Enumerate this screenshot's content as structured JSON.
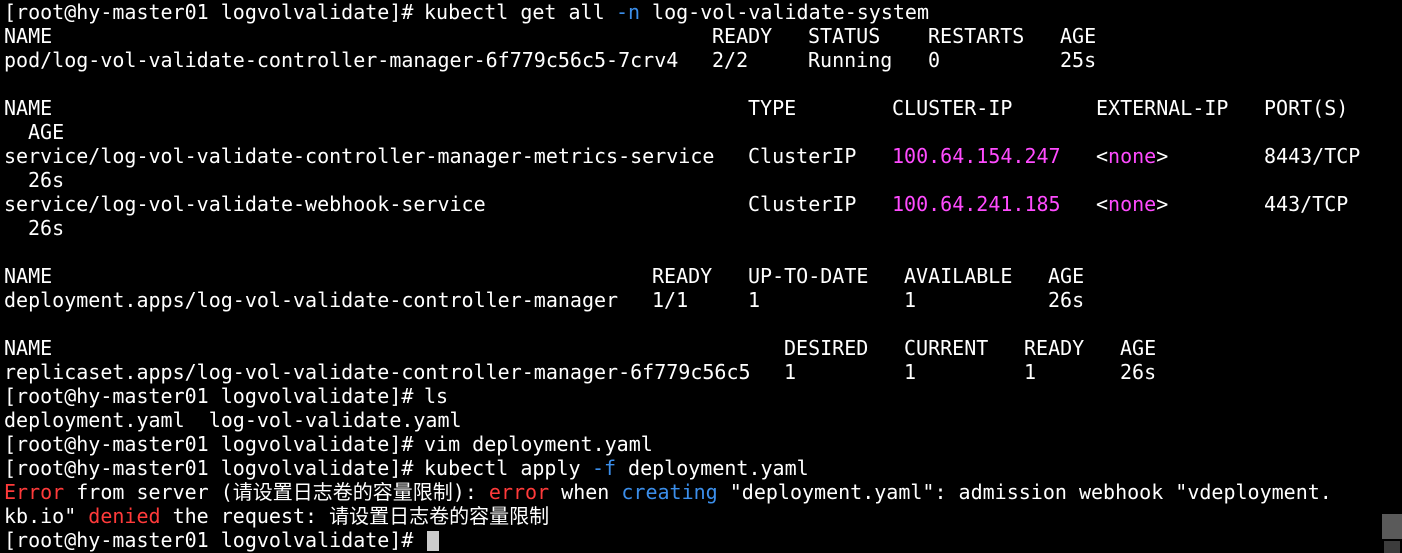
{
  "prompt": "[root@hy-master01 logvolvalidate]# ",
  "commands": {
    "get_all": {
      "cmd": "kubectl get all ",
      "flag": "-n",
      "arg": " log-vol-validate-system"
    },
    "ls": "ls",
    "vim": "vim deployment.yaml",
    "apply": {
      "cmd": "kubectl apply ",
      "flag": "-f",
      "arg": " deployment.yaml"
    }
  },
  "pods": {
    "headers": [
      "NAME",
      "READY",
      "STATUS",
      "RESTARTS",
      "AGE"
    ],
    "rows": [
      [
        "pod/log-vol-validate-controller-manager-6f779c56c5-7crv4",
        "2/2",
        "Running",
        "0",
        "25s"
      ]
    ]
  },
  "services": {
    "headers": [
      "NAME",
      "TYPE",
      "CLUSTER-IP",
      "EXTERNAL-IP",
      "PORT(S)",
      "AGE"
    ],
    "rows": [
      [
        "service/log-vol-validate-controller-manager-metrics-service",
        "ClusterIP",
        "100.64.154.247",
        "<none>",
        "8443/TCP",
        "26s"
      ],
      [
        "service/log-vol-validate-webhook-service",
        "ClusterIP",
        "100.64.241.185",
        "<none>",
        "443/TCP",
        "26s"
      ]
    ]
  },
  "deployments": {
    "headers": [
      "NAME",
      "READY",
      "UP-TO-DATE",
      "AVAILABLE",
      "AGE"
    ],
    "rows": [
      [
        "deployment.apps/log-vol-validate-controller-manager",
        "1/1",
        "1",
        "1",
        "26s"
      ]
    ]
  },
  "replicasets": {
    "headers": [
      "NAME",
      "DESIRED",
      "CURRENT",
      "READY",
      "AGE"
    ],
    "rows": [
      [
        "replicaset.apps/log-vol-validate-controller-manager-6f779c56c5",
        "1",
        "1",
        "1",
        "26s"
      ]
    ]
  },
  "ls_output": "deployment.yaml  log-vol-validate.yaml",
  "error": {
    "word_error": "Error",
    "part1": " from server (请设置日志卷的容量限制): ",
    "word_error2": "error",
    "part2": " when ",
    "word_creating": "creating",
    "part3": " \"deployment.yaml\": admission webhook \"vdeployment.",
    "part4": "kb.io\" ",
    "word_denied": "denied",
    "part5": " the request: 请设置日志卷的容量限制"
  },
  "colors": {
    "background": "#000000",
    "text": "#ffffff",
    "ip": "#ff4bff",
    "error": "#ff3a3a",
    "keyword": "#3b8eea"
  }
}
